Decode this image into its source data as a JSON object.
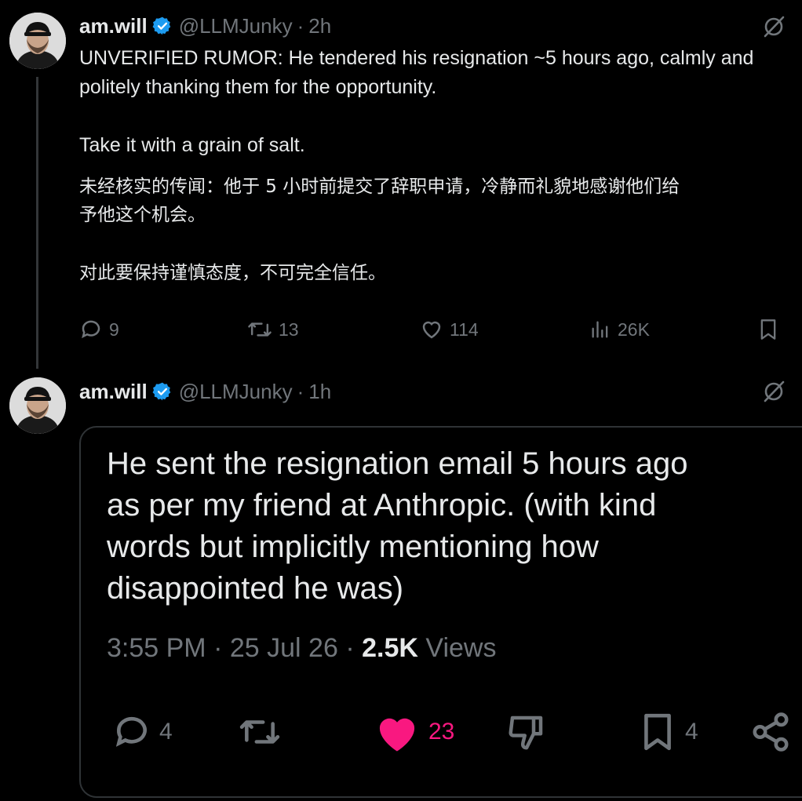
{
  "tweet1": {
    "name": "am.will",
    "handle": "@LLMJunky",
    "sep": "·",
    "time": "2h",
    "lines": [
      "UNVERIFIED RUMOR: He tendered his resignation ~5 hours ago, calmly and",
      "politely thanking them for the opportunity.",
      "Take it with a grain of salt."
    ],
    "cjk_lines": [
      "未经核实的传闻：他于 5 小时前提交了辞职申请，冷静而礼貌地感谢他们给",
      "予他这个机会。",
      "对此要保持谨慎态度，不可完全信任。"
    ],
    "actions": {
      "replies": "9",
      "reposts": "13",
      "likes": "114",
      "views": "26K"
    }
  },
  "tweet2": {
    "name": "am.will",
    "handle": "@LLMJunky",
    "sep": "·",
    "time": "1h",
    "quoted": {
      "text_lines": [
        "He sent the resignation email 5 hours ago",
        "as per my friend at Anthropic. (with kind",
        "words but implicitly mentioning how",
        "disappointed he was)"
      ],
      "time": "3:55 PM",
      "date": "25 Jul 26",
      "views_count": "2.5K",
      "views_label": "Views",
      "meta_sep": "·",
      "actions": {
        "replies": "4",
        "likes": "23",
        "bookmarks": "4"
      }
    }
  },
  "colors": {
    "background": "#000000",
    "text": "#e7e9ea",
    "muted": "#71767b",
    "verified": "#1d9bf0",
    "like": "#f91880"
  }
}
